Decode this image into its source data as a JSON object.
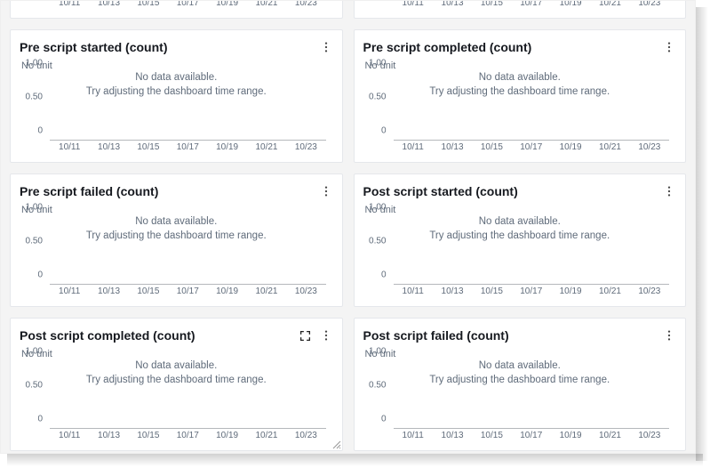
{
  "common": {
    "unit_label": "No unit",
    "no_data_line1": "No data available.",
    "no_data_line2": "Try adjusting the dashboard time range.",
    "x_ticks": [
      "10/11",
      "10/13",
      "10/15",
      "10/17",
      "10/19",
      "10/21",
      "10/23"
    ],
    "y_ticks": [
      {
        "label": "0",
        "pct": 0
      },
      {
        "label": "0.50",
        "pct": 50
      },
      {
        "label": "1.00",
        "pct": 100
      }
    ],
    "partial_y_ticks": [
      {
        "label": "0",
        "pct": 0
      }
    ]
  },
  "panels": [
    {
      "id": "partial-left",
      "title": "",
      "partial": true,
      "has_expand": false,
      "has_resize": false
    },
    {
      "id": "partial-right",
      "title": "",
      "partial": true,
      "has_expand": false,
      "has_resize": false
    },
    {
      "id": "pre-started",
      "title": "Pre script started (count)",
      "partial": false,
      "has_expand": false,
      "has_resize": false
    },
    {
      "id": "pre-completed",
      "title": "Pre script completed (count)",
      "partial": false,
      "has_expand": false,
      "has_resize": false
    },
    {
      "id": "pre-failed",
      "title": "Pre script failed (count)",
      "partial": false,
      "has_expand": false,
      "has_resize": false
    },
    {
      "id": "post-started",
      "title": "Post script started (count)",
      "partial": false,
      "has_expand": false,
      "has_resize": false
    },
    {
      "id": "post-completed",
      "title": "Post script completed (count)",
      "partial": false,
      "has_expand": true,
      "has_resize": true
    },
    {
      "id": "post-failed",
      "title": "Post script failed (count)",
      "partial": false,
      "has_expand": false,
      "has_resize": false
    }
  ],
  "chart_data": [
    {
      "panel": "partial-left",
      "type": "line",
      "title": "",
      "xlabel": "",
      "ylabel": "No unit",
      "x": [
        "10/11",
        "10/13",
        "10/15",
        "10/17",
        "10/19",
        "10/21",
        "10/23"
      ],
      "values": [],
      "ylim": [
        0,
        1
      ],
      "note": "No data available."
    },
    {
      "panel": "partial-right",
      "type": "line",
      "title": "",
      "xlabel": "",
      "ylabel": "No unit",
      "x": [
        "10/11",
        "10/13",
        "10/15",
        "10/17",
        "10/19",
        "10/21",
        "10/23"
      ],
      "values": [],
      "ylim": [
        0,
        1
      ],
      "note": "No data available."
    },
    {
      "panel": "pre-started",
      "type": "line",
      "title": "Pre script started (count)",
      "xlabel": "",
      "ylabel": "No unit",
      "x": [
        "10/11",
        "10/13",
        "10/15",
        "10/17",
        "10/19",
        "10/21",
        "10/23"
      ],
      "values": [],
      "ylim": [
        0,
        1
      ],
      "note": "No data available."
    },
    {
      "panel": "pre-completed",
      "type": "line",
      "title": "Pre script completed (count)",
      "xlabel": "",
      "ylabel": "No unit",
      "x": [
        "10/11",
        "10/13",
        "10/15",
        "10/17",
        "10/19",
        "10/21",
        "10/23"
      ],
      "values": [],
      "ylim": [
        0,
        1
      ],
      "note": "No data available."
    },
    {
      "panel": "pre-failed",
      "type": "line",
      "title": "Pre script failed (count)",
      "xlabel": "",
      "ylabel": "No unit",
      "x": [
        "10/11",
        "10/13",
        "10/15",
        "10/17",
        "10/19",
        "10/21",
        "10/23"
      ],
      "values": [],
      "ylim": [
        0,
        1
      ],
      "note": "No data available."
    },
    {
      "panel": "post-started",
      "type": "line",
      "title": "Post script started (count)",
      "xlabel": "",
      "ylabel": "No unit",
      "x": [
        "10/11",
        "10/13",
        "10/15",
        "10/17",
        "10/19",
        "10/21",
        "10/23"
      ],
      "values": [],
      "ylim": [
        0,
        1
      ],
      "note": "No data available."
    },
    {
      "panel": "post-completed",
      "type": "line",
      "title": "Post script completed (count)",
      "xlabel": "",
      "ylabel": "No unit",
      "x": [
        "10/11",
        "10/13",
        "10/15",
        "10/17",
        "10/19",
        "10/21",
        "10/23"
      ],
      "values": [],
      "ylim": [
        0,
        1
      ],
      "note": "No data available."
    },
    {
      "panel": "post-failed",
      "type": "line",
      "title": "Post script failed (count)",
      "xlabel": "",
      "ylabel": "No unit",
      "x": [
        "10/11",
        "10/13",
        "10/15",
        "10/17",
        "10/19",
        "10/21",
        "10/23"
      ],
      "values": [],
      "ylim": [
        0,
        1
      ],
      "note": "No data available."
    }
  ]
}
